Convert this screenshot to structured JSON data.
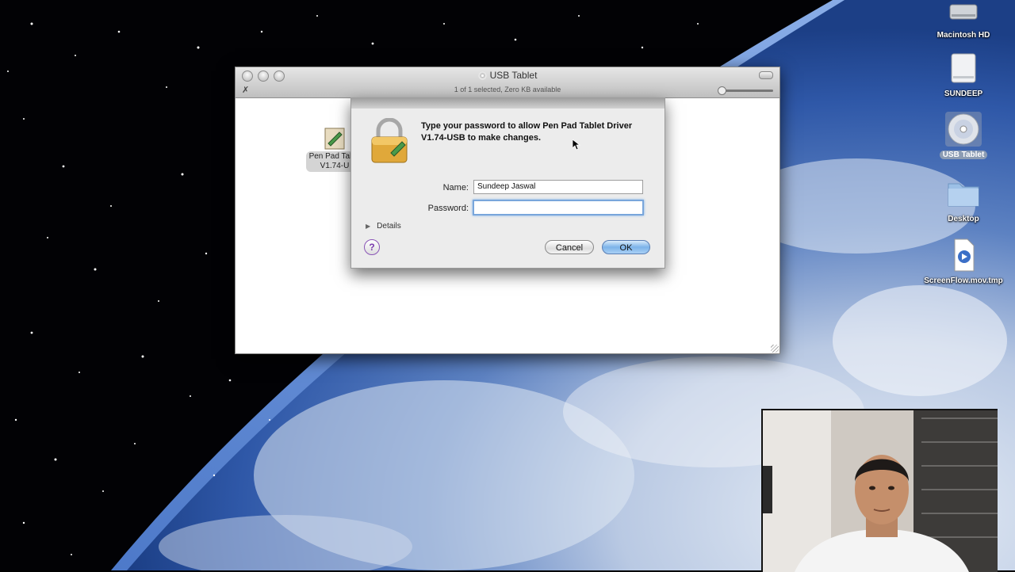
{
  "desktop": {
    "icons": [
      {
        "label": "Macintosh HD",
        "kind": "harddisk-icon",
        "selected": false
      },
      {
        "label": "SUNDEEP",
        "kind": "external-drive-icon",
        "selected": false
      },
      {
        "label": "USB Tablet",
        "kind": "cd-disc-icon",
        "selected": true
      },
      {
        "label": "Desktop",
        "kind": "folder-icon",
        "selected": false
      },
      {
        "label": "ScreenFlow.mov.tmp",
        "kind": "movie-file-icon",
        "selected": false
      }
    ]
  },
  "finder": {
    "title": "USB Tablet",
    "status": "1 of 1 selected, Zero KB available",
    "file": {
      "label_line1": "Pen Pad Table",
      "label_line2": "V1.74-U"
    }
  },
  "auth": {
    "prompt": "Type your password to allow Pen Pad Tablet Driver V1.74-USB to make changes.",
    "name_label": "Name:",
    "name_value": "Sundeep Jaswal",
    "password_label": "Password:",
    "password_value": "",
    "details_label": "Details",
    "help_label": "?",
    "cancel_label": "Cancel",
    "ok_label": "OK"
  },
  "colors": {
    "accent_button": "#7cb3e9",
    "focus_ring": "#79a6db",
    "selection_label": "#8c9cb3"
  }
}
